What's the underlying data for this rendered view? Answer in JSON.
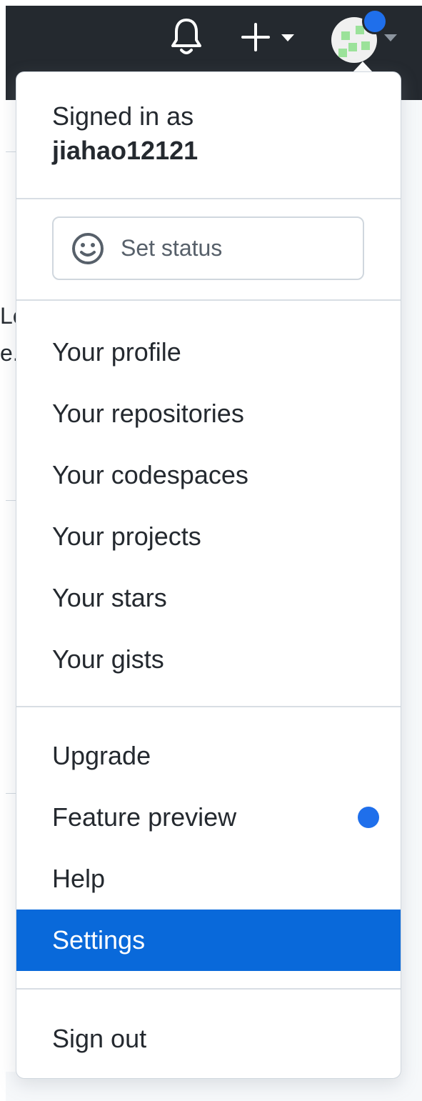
{
  "header": {
    "signed_in_prefix": "Signed in as",
    "username": "jiahao12121"
  },
  "status_button": {
    "label": "Set status",
    "icon": "smiley-icon"
  },
  "menu_groups": {
    "profile": [
      {
        "label": "Your profile"
      },
      {
        "label": "Your repositories"
      },
      {
        "label": "Your codespaces"
      },
      {
        "label": "Your projects"
      },
      {
        "label": "Your stars"
      },
      {
        "label": "Your gists"
      }
    ],
    "account": [
      {
        "label": "Upgrade"
      },
      {
        "label": "Feature preview",
        "badge": "dot"
      },
      {
        "label": "Help"
      },
      {
        "label": "Settings",
        "state": "highlighted"
      }
    ],
    "session": [
      {
        "label": "Sign out"
      }
    ]
  },
  "topbar_icons": [
    "bell-icon",
    "plus-icon",
    "chevron-down-icon",
    "avatar"
  ],
  "background_fragments": {
    "line1": "Le",
    "line2": "e."
  },
  "colors": {
    "topbar": "#24292f",
    "highlight": "#0969da",
    "notification_dot": "#1f6feb"
  }
}
